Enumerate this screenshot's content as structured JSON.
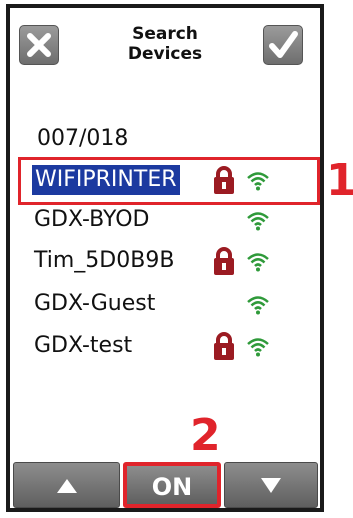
{
  "header": {
    "title_line1": "Search",
    "title_line2": "Devices",
    "cancel_icon": "close-icon",
    "confirm_icon": "checkmark-icon"
  },
  "counter": "007/018",
  "networks": [
    {
      "ssid": "WIFIPRINTER",
      "locked": true,
      "selected": true
    },
    {
      "ssid": "GDX-BYOD",
      "locked": false,
      "selected": false
    },
    {
      "ssid": "Tim_5D0B9B",
      "locked": true,
      "selected": false
    },
    {
      "ssid": "GDX-Guest",
      "locked": false,
      "selected": false
    },
    {
      "ssid": "GDX-test",
      "locked": true,
      "selected": false
    }
  ],
  "callouts": {
    "one": "1",
    "two": "2"
  },
  "bottom_bar": {
    "up_icon": "triangle-up-icon",
    "on_label": "ON",
    "down_icon": "triangle-down-icon"
  },
  "colors": {
    "highlight_red": "#e0242b",
    "selection_blue": "#1c3aa0",
    "lock_red": "#9b1b22",
    "wifi_green": "#2f9a3a",
    "button_gray": "#6e6e6e"
  }
}
